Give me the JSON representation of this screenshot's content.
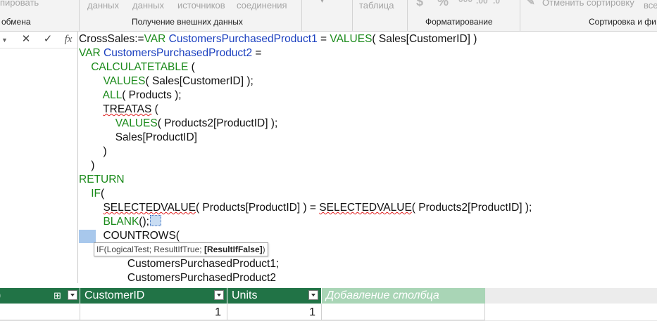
{
  "ribbon": {
    "partial_top_left": "пировать",
    "partial_buttons": [
      "данных",
      "данных",
      "источников",
      "соединения"
    ],
    "table_label": "таблица",
    "format_icons": [
      "$",
      "%",
      "000",
      ".00",
      ".0"
    ],
    "sort_clear_label": "Отменить сортировку",
    "partial_right": "все",
    "groups": {
      "clipboard": "обмена",
      "external_data": "Получение внешних данных",
      "formatting": "Форматирование",
      "sort_filter": "Сортировка и фи"
    }
  },
  "formula_bar": {
    "cancel_icon": "✕",
    "confirm_icon": "✓",
    "fx_label": "fx"
  },
  "formula": {
    "lines": [
      {
        "indent": "",
        "parts": [
          [
            "CrossSales:=",
            "plain"
          ],
          [
            "VAR ",
            "kw"
          ],
          [
            "CustomersPurchasedProduct1",
            "var"
          ],
          [
            " = ",
            "plain"
          ],
          [
            "VALUES",
            "kw"
          ],
          [
            "( Sales[CustomerID] )",
            "plain"
          ]
        ]
      },
      {
        "indent": "",
        "parts": [
          [
            "VAR ",
            "kw"
          ],
          [
            "CustomersPurchasedProduct2",
            "var"
          ],
          [
            " =",
            "plain"
          ]
        ]
      },
      {
        "indent": "    ",
        "parts": [
          [
            "CALCULATETABLE",
            "kw"
          ],
          [
            " (",
            "plain"
          ]
        ]
      },
      {
        "indent": "        ",
        "parts": [
          [
            "VALUES",
            "kw"
          ],
          [
            "( Sales[CustomerID] );",
            "plain"
          ]
        ]
      },
      {
        "indent": "        ",
        "parts": [
          [
            "ALL",
            "kw"
          ],
          [
            "( Products );",
            "plain"
          ]
        ]
      },
      {
        "indent": "        ",
        "parts": [
          [
            "TREATAS",
            "sq"
          ],
          [
            " (",
            "plain"
          ]
        ]
      },
      {
        "indent": "            ",
        "parts": [
          [
            "VALUES",
            "kw"
          ],
          [
            "( Products2[ProductID] );",
            "plain"
          ]
        ]
      },
      {
        "indent": "            ",
        "parts": [
          [
            "Sales[ProductID]",
            "plain"
          ]
        ]
      },
      {
        "indent": "        ",
        "parts": [
          [
            ")",
            "plain"
          ]
        ]
      },
      {
        "indent": "    ",
        "parts": [
          [
            ")",
            "plain"
          ]
        ]
      },
      {
        "indent": "",
        "parts": [
          [
            "RETURN",
            "kw"
          ]
        ]
      },
      {
        "indent": "    ",
        "parts": [
          [
            "IF",
            "kw"
          ],
          [
            "(",
            "plain"
          ]
        ]
      },
      {
        "indent": "        ",
        "parts": [
          [
            "SELECTEDVALUE",
            "sq"
          ],
          [
            "( Products[ProductID] ) = ",
            "plain"
          ],
          [
            "SELECTEDVALUE",
            "sq"
          ],
          [
            "( Products2[ProductID] );",
            "plain"
          ]
        ]
      },
      {
        "indent": "        ",
        "parts": [
          [
            "BLANK",
            "kw"
          ],
          [
            "();",
            "plain"
          ]
        ]
      },
      {
        "indent": "        ",
        "parts": [
          [
            "COUNTROWS(",
            "plain"
          ]
        ]
      },
      {
        "indent": "",
        "parts": []
      },
      {
        "indent": "                ",
        "parts": [
          [
            "CustomersPurchasedProduct1;",
            "plain"
          ]
        ]
      },
      {
        "indent": "                ",
        "parts": [
          [
            "CustomersPurchasedProduct2",
            "plain"
          ]
        ]
      }
    ],
    "tooltip": {
      "plain": "IF(LogicalTest; ResultIfTrue; ",
      "bold": "[ResultIfFalse]",
      "end": ")"
    }
  },
  "table": {
    "columns": [
      {
        "label": "",
        "width": 114
      },
      {
        "label": "CustomerID",
        "width": 209
      },
      {
        "label": "Units",
        "width": 133
      }
    ],
    "add_column_label": "Добавление столбца",
    "row": [
      "",
      "1",
      "1"
    ]
  },
  "colors": {
    "header_green": "#217346",
    "add_column_green": "#a9d5b6",
    "keyword_green": "#1a8a1a",
    "variable_blue": "#1a3fbf"
  }
}
